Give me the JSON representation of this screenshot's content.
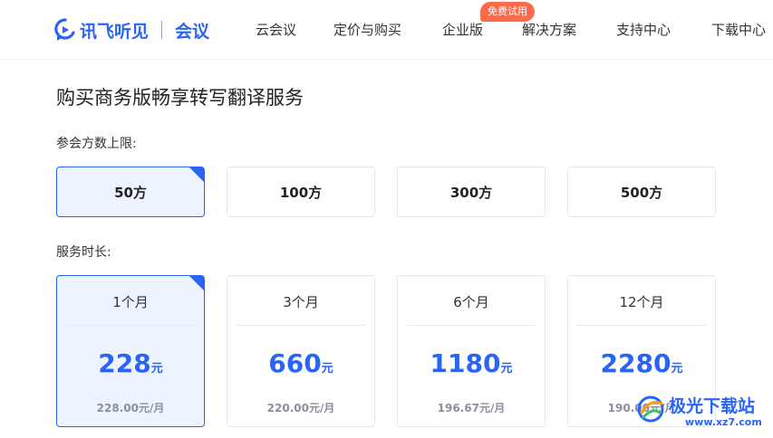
{
  "header": {
    "brand": "讯飞听见",
    "product": "会议",
    "nav": [
      {
        "label": "云会议"
      },
      {
        "label": "定价与购买"
      },
      {
        "label": "企业版"
      },
      {
        "label": "解决方案"
      },
      {
        "label": "支持中心"
      },
      {
        "label": "下载中心"
      }
    ],
    "badge": "免费试用"
  },
  "page": {
    "title": "购买商务版畅享转写翻译服务"
  },
  "participants": {
    "label": "参会方数上限:",
    "selected_index": 0,
    "options": [
      {
        "label": "50方"
      },
      {
        "label": "100方"
      },
      {
        "label": "300方"
      },
      {
        "label": "500方"
      }
    ]
  },
  "duration": {
    "label": "服务时长:",
    "selected_index": 0,
    "plans": [
      {
        "name": "1个月",
        "price": "228",
        "unit": "元",
        "monthly": "228.00元/月"
      },
      {
        "name": "3个月",
        "price": "660",
        "unit": "元",
        "monthly": "220.00元/月"
      },
      {
        "name": "6个月",
        "price": "1180",
        "unit": "元",
        "monthly": "196.67元/月"
      },
      {
        "name": "12个月",
        "price": "2280",
        "unit": "元",
        "monthly": "190.00元/月"
      }
    ]
  },
  "watermark": {
    "title": "极光下载站",
    "url": "www.xz7.com"
  },
  "colors": {
    "accent": "#2a64f6",
    "badge": "#ff6b4a",
    "selected_bg": "#eef4ff"
  }
}
